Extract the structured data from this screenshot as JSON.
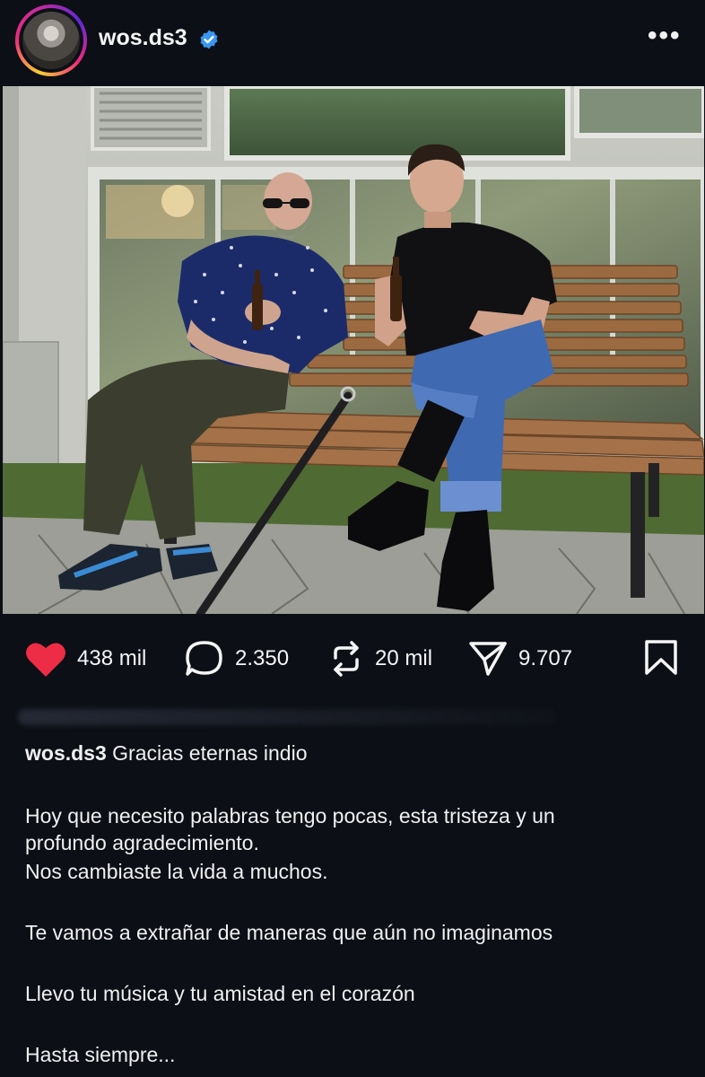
{
  "post": {
    "username": "wos.ds3",
    "more_label": "•••"
  },
  "actions": {
    "likes": "438 mil",
    "comments": "2.350",
    "reposts": "20 mil",
    "shares": "9.707",
    "like_color": "#ed2c45"
  },
  "caption": {
    "username": "wos.ds3",
    "first_line": "Gracias eternas indio",
    "lines": [
      "Hoy que necesito palabras tengo pocas, esta tristeza y un",
      "profundo agradecimiento.",
      "Nos cambiaste la vida a muchos.",
      "Te vamos a extrañar de maneras que aún no imaginamos",
      "Llevo tu música y tu amistad en el corazón",
      "Hasta siempre..."
    ]
  },
  "icons": {
    "verified": "verified-badge-icon",
    "like": "heart-icon",
    "comment": "comment-bubble-icon",
    "repost": "repost-icon",
    "share": "send-icon",
    "save": "bookmark-icon"
  }
}
